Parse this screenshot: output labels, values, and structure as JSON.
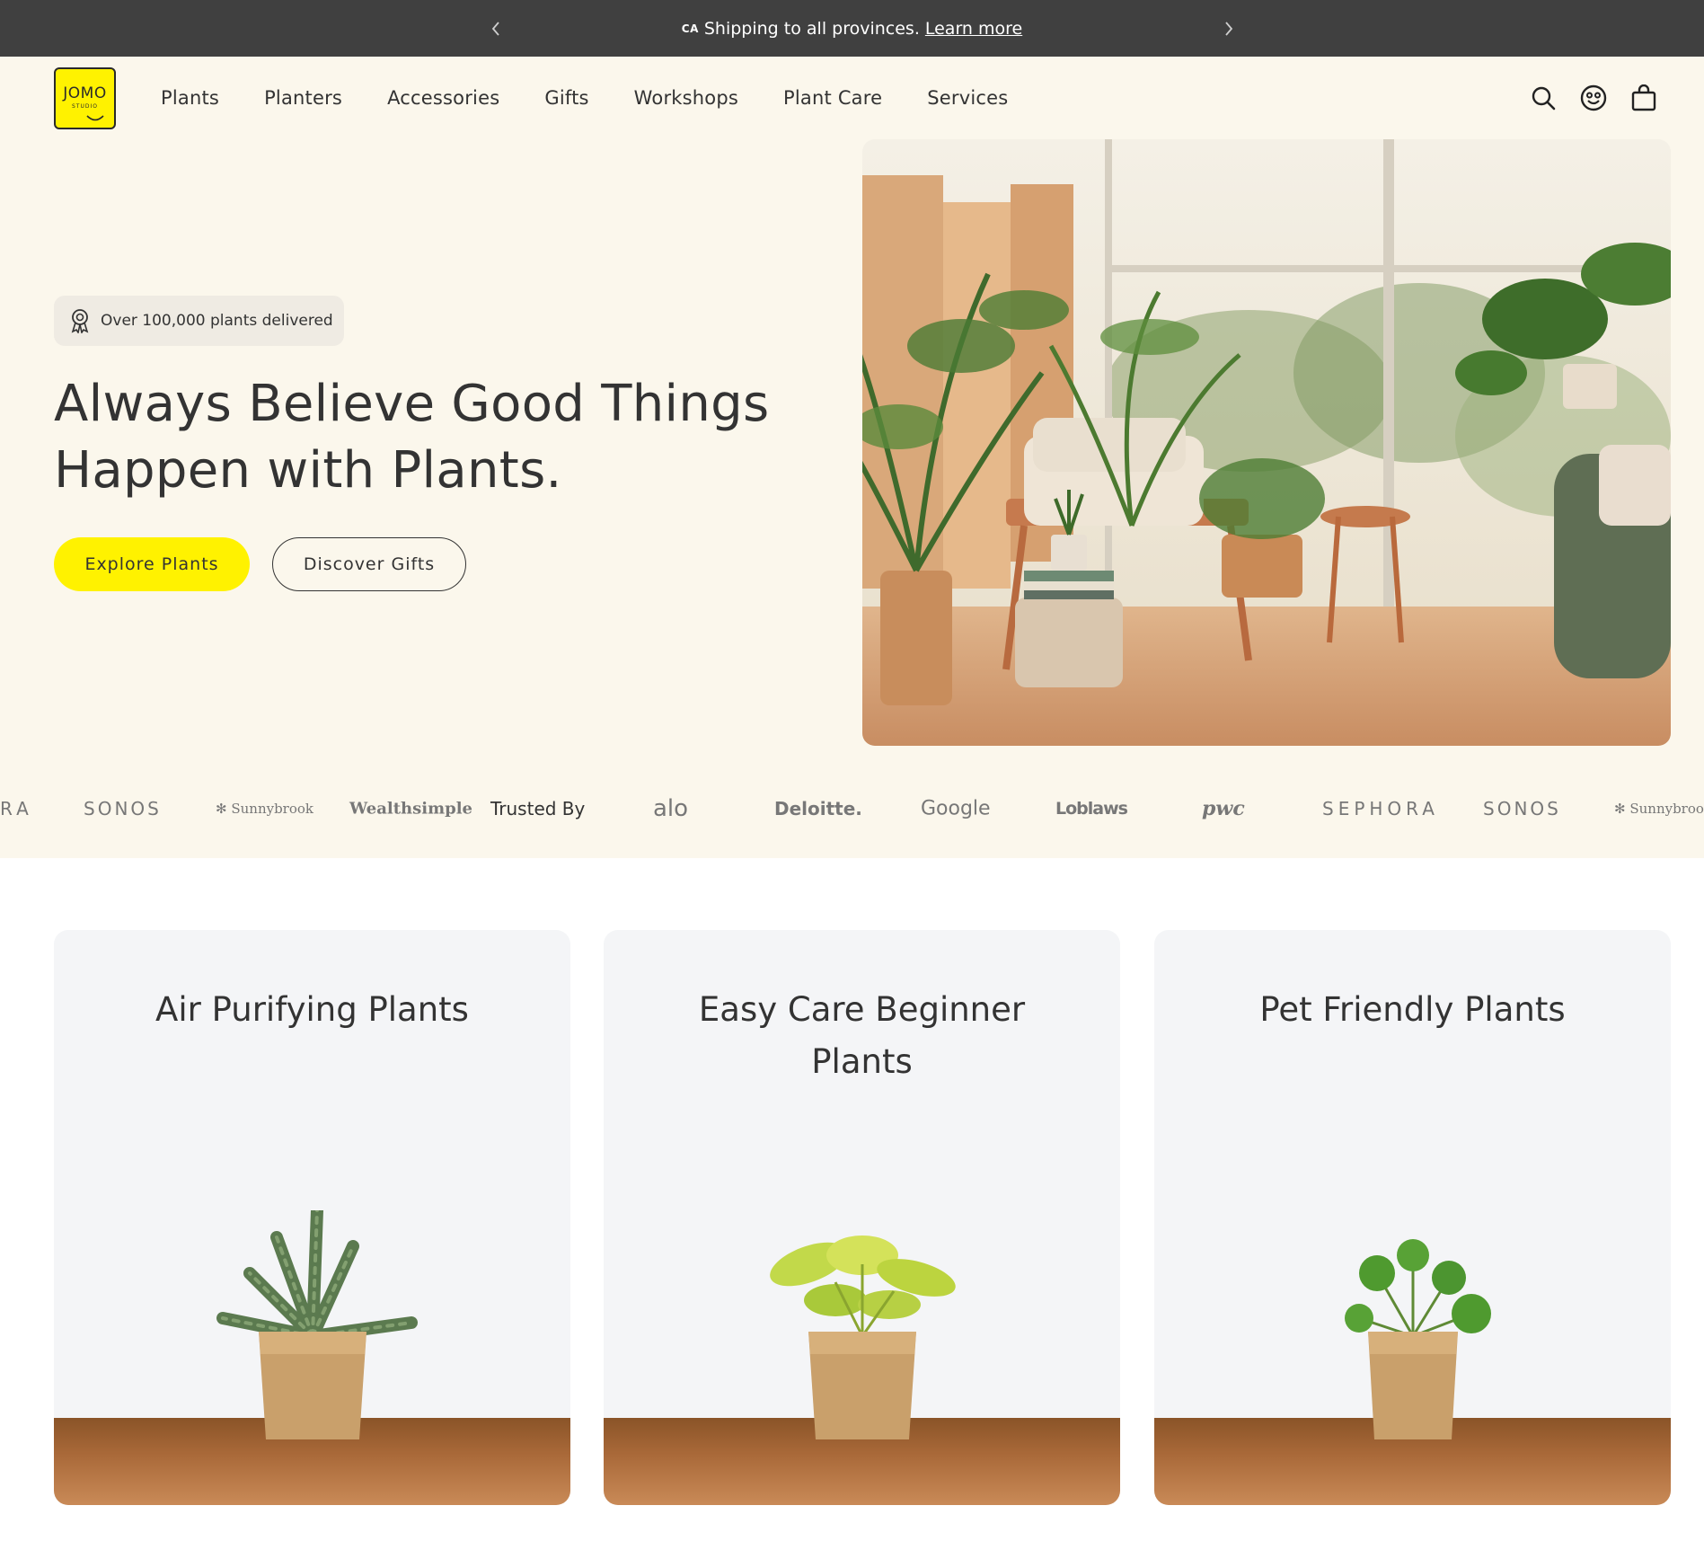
{
  "announcement": {
    "country_code": "CA",
    "text": "Shipping to all provinces.",
    "link": "Learn more"
  },
  "brand": {
    "logo_word": "JOMO",
    "logo_sub": "STUDIO",
    "accent": "#fff200",
    "cream": "#fbf7ec"
  },
  "nav": {
    "items": [
      "Plants",
      "Planters",
      "Accessories",
      "Gifts",
      "Workshops",
      "Plant Care",
      "Services"
    ]
  },
  "header_icons": [
    "search-icon",
    "account-icon",
    "bag-icon"
  ],
  "hero": {
    "badge": "Over 100,000 plants delivered",
    "title_line1": "Always Believe Good Things",
    "title_line2": "Happen with Plants.",
    "primary_cta": "Explore Plants",
    "secondary_cta": "Discover Gifts"
  },
  "logos": {
    "trusted_label": "Trusted By",
    "items": [
      "RA",
      "SONOS",
      "Sunnybrook",
      "Wealthsimple",
      "alo",
      "Deloitte.",
      "Google",
      "Loblaws",
      "pwc",
      "SEPHORA",
      "SONOS",
      "Sunnybrook"
    ]
  },
  "categories": [
    {
      "title": "Air Purifying Plants"
    },
    {
      "title": "Easy Care Beginner Plants"
    },
    {
      "title": "Pet Friendly Plants"
    }
  ]
}
